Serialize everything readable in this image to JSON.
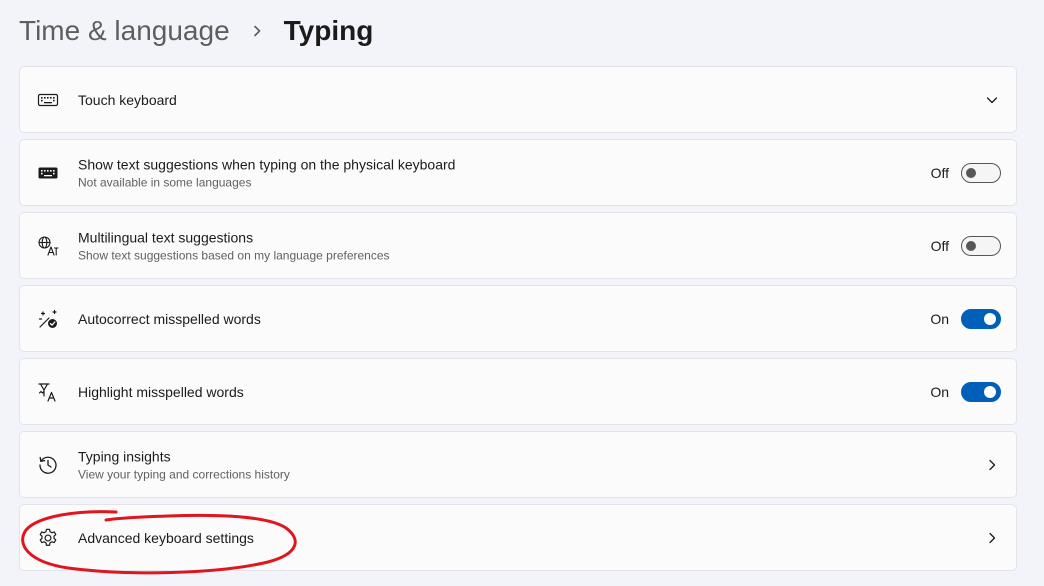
{
  "breadcrumb": {
    "parent": "Time & language",
    "separator_icon": "chevron-right-icon",
    "current": "Typing"
  },
  "items": [
    {
      "icon": "keyboard-outline-icon",
      "title": "Touch keyboard",
      "control": "expand",
      "control_icon": "chevron-down-icon"
    },
    {
      "icon": "keyboard-filled-icon",
      "title": "Show text suggestions when typing on the physical keyboard",
      "subtitle": "Not available in some languages",
      "control": "toggle",
      "state_label": "Off",
      "on": false
    },
    {
      "icon": "multilingual-icon",
      "title": "Multilingual text suggestions",
      "subtitle": "Show text suggestions based on my language preferences",
      "control": "toggle",
      "state_label": "Off",
      "on": false
    },
    {
      "icon": "autocorrect-icon",
      "title": "Autocorrect misspelled words",
      "control": "toggle",
      "state_label": "On",
      "on": true
    },
    {
      "icon": "highlight-misspelled-icon",
      "title": "Highlight misspelled words",
      "control": "toggle",
      "state_label": "On",
      "on": true
    },
    {
      "icon": "history-icon",
      "title": "Typing insights",
      "subtitle": "View your typing and corrections history",
      "control": "navigate",
      "control_icon": "chevron-right-icon"
    },
    {
      "icon": "gear-icon",
      "title": "Advanced keyboard settings",
      "control": "navigate",
      "control_icon": "chevron-right-icon",
      "annotated": true
    }
  ],
  "colors": {
    "background": "#f3f4f9",
    "card": "#fbfbfc",
    "card_border": "#e3e4e8",
    "accent": "#005fb8",
    "annotation": "#e0161e"
  }
}
